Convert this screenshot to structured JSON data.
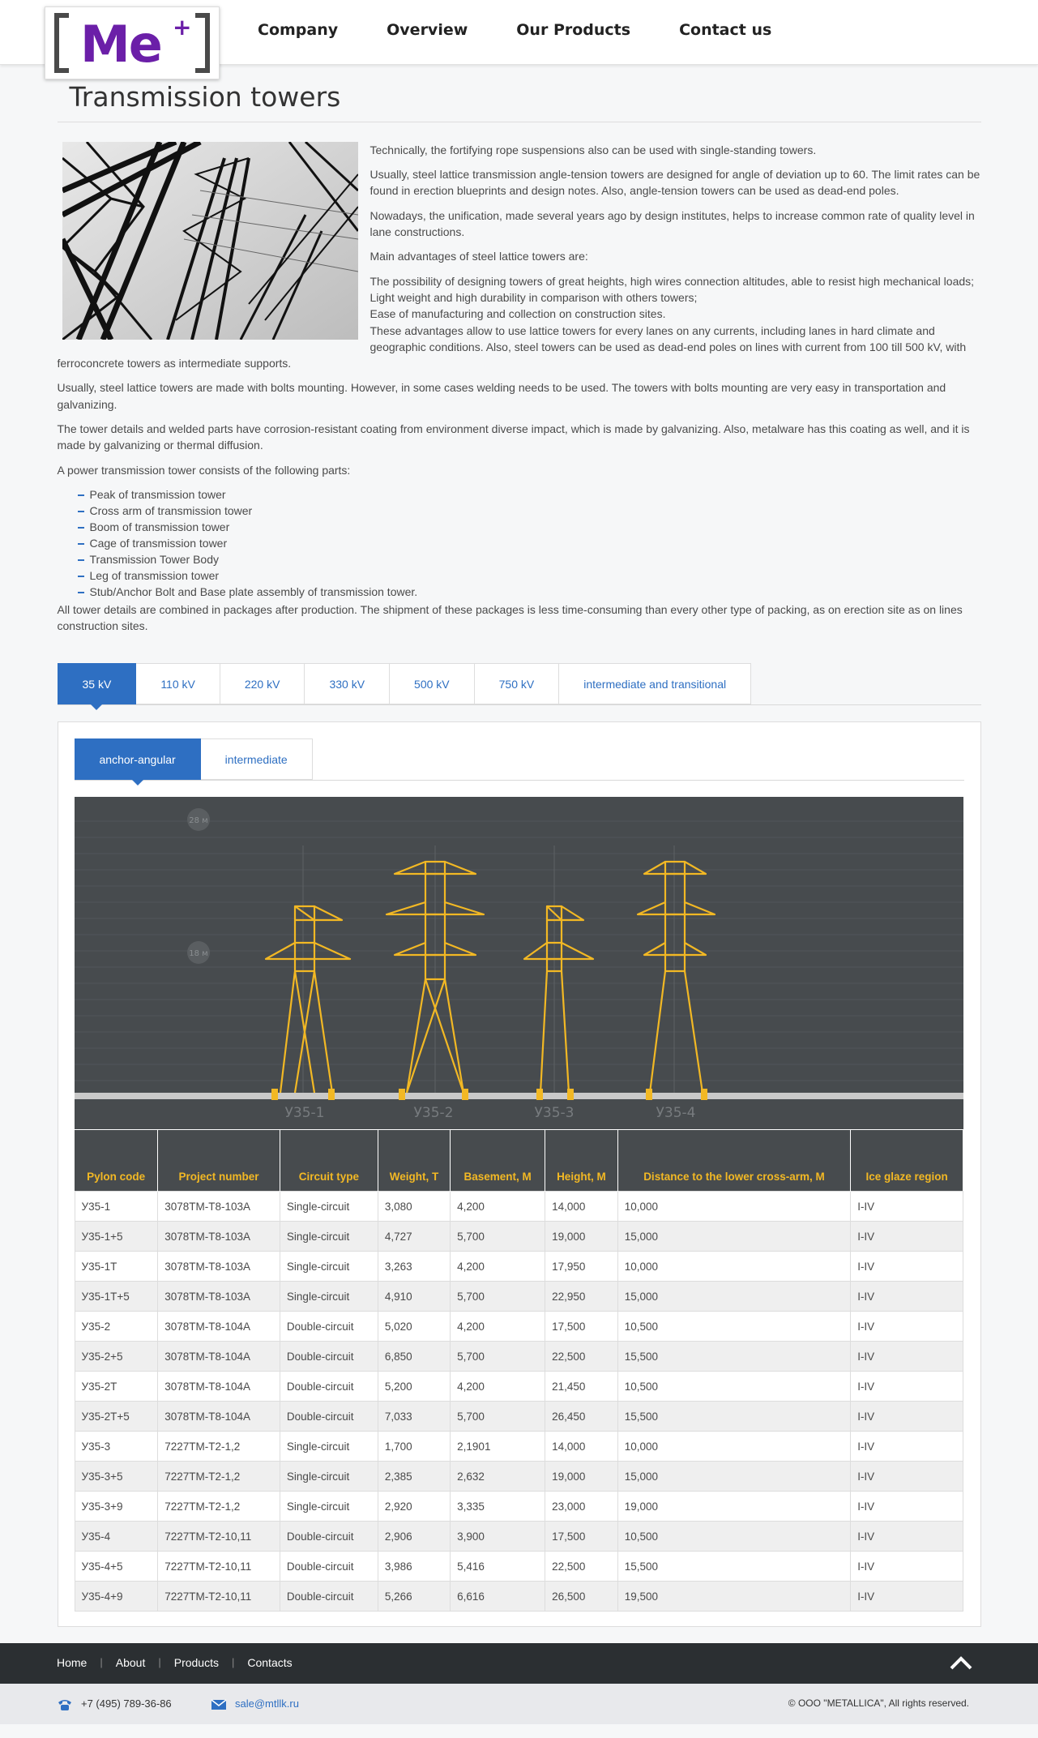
{
  "nav": {
    "logo_text": "Me",
    "logo_sup": "+",
    "items": [
      "Company",
      "Overview",
      "Our Products",
      "Contact us"
    ]
  },
  "page": {
    "title": "Transmission towers",
    "paragraphs": [
      "Technically, the fortifying rope suspensions also can be used with single-standing towers.",
      "Usually, steel lattice transmission angle-tension towers are designed for angle of deviation up to 60. The limit rates can be found in erection blueprints and design notes. Also, angle-tension towers can be used as dead-end poles.",
      "Nowadays, the unification, made several years ago by design institutes, helps to increase common rate of quality level in lane constructions.",
      "Main advantages of steel lattice towers are:"
    ],
    "advantages": [
      "The possibility of designing towers of great heights, high wires connection altitudes, able to resist high mechanical loads;",
      "Light weight and high durability in comparison with others towers;",
      "Ease of manufacturing and collection on construction sites."
    ],
    "paragraphs2": [
      "These advantages allow to use lattice towers for every lanes on any currents, including lanes in hard climate and geographic conditions. Also, steel towers can be used as dead-end poles on lines with current from 100 till 500 kV, with ferroconcrete towers as intermediate supports.",
      "Usually, steel lattice towers are made with bolts mounting. However, in some cases welding needs to be used. The towers with bolts mounting are very easy in transportation and galvanizing.",
      "The tower details and welded parts have corrosion-resistant coating from environment diverse impact, which is made by galvanizing. Also, metalware has this coating as well, and it is made by galvanizing or thermal diffusion.",
      "A power transmission tower consists of the following parts:"
    ],
    "parts": [
      "Peak of transmission tower",
      "Cross arm of transmission tower",
      "Boom of transmission tower",
      "Cage of transmission tower",
      "Transmission Tower Body",
      "Leg of transmission tower",
      "Stub/Anchor Bolt and Base plate assembly of transmission tower."
    ],
    "final": "All tower details are combined in packages after production. The shipment of these packages is less time-consuming than every other type of packing, as on erection site as on lines construction sites."
  },
  "tabs": [
    "35 kV",
    "110 kV",
    "220 kV",
    "330 kV",
    "500 kV",
    "750 kV",
    "intermediate and transitional"
  ],
  "subtabs": [
    "anchor-angular",
    "intermediate"
  ],
  "diagram": {
    "height_marks": [
      "28 м",
      "18 м"
    ],
    "tower_labels": [
      "У35-1",
      "У35-2",
      "У35-3",
      "У35-4"
    ]
  },
  "table": {
    "headers": [
      "Pylon code",
      "Project number",
      "Circuit type",
      "Weight, T",
      "Basement, M",
      "Height, M",
      "Distance to the lower cross-arm, M",
      "Ice glaze region"
    ],
    "rows": [
      [
        "У35-1",
        "3078TM-T8-103A",
        "Single-circuit",
        "3,080",
        "4,200",
        "14,000",
        "10,000",
        "I-IV"
      ],
      [
        "У35-1+5",
        "3078TM-T8-103A",
        "Single-circuit",
        "4,727",
        "5,700",
        "19,000",
        "15,000",
        "I-IV"
      ],
      [
        "У35-1T",
        "3078TM-T8-103A",
        "Single-circuit",
        "3,263",
        "4,200",
        "17,950",
        "10,000",
        "I-IV"
      ],
      [
        "У35-1T+5",
        "3078TM-T8-103A",
        "Single-circuit",
        "4,910",
        "5,700",
        "22,950",
        "15,000",
        "I-IV"
      ],
      [
        "У35-2",
        "3078TM-T8-104A",
        "Double-circuit",
        "5,020",
        "4,200",
        "17,500",
        "10,500",
        "I-IV"
      ],
      [
        "У35-2+5",
        "3078TM-T8-104A",
        "Double-circuit",
        "6,850",
        "5,700",
        "22,500",
        "15,500",
        "I-IV"
      ],
      [
        "У35-2T",
        "3078TM-T8-104A",
        "Double-circuit",
        "5,200",
        "4,200",
        "21,450",
        "10,500",
        "I-IV"
      ],
      [
        "У35-2T+5",
        "3078TM-T8-104A",
        "Double-circuit",
        "7,033",
        "5,700",
        "26,450",
        "15,500",
        "I-IV"
      ],
      [
        "У35-3",
        "7227TM-T2-1,2",
        "Single-circuit",
        "1,700",
        "2,1901",
        "14,000",
        "10,000",
        "I-IV"
      ],
      [
        "У35-3+5",
        "7227TM-T2-1,2",
        "Single-circuit",
        "2,385",
        "2,632",
        "19,000",
        "15,000",
        "I-IV"
      ],
      [
        "У35-3+9",
        "7227TM-T2-1,2",
        "Single-circuit",
        "2,920",
        "3,335",
        "23,000",
        "19,000",
        "I-IV"
      ],
      [
        "У35-4",
        "7227TM-T2-10,11",
        "Double-circuit",
        "2,906",
        "3,900",
        "17,500",
        "10,500",
        "I-IV"
      ],
      [
        "У35-4+5",
        "7227TM-T2-10,11",
        "Double-circuit",
        "3,986",
        "5,416",
        "22,500",
        "15,500",
        "I-IV"
      ],
      [
        "У35-4+9",
        "7227TM-T2-10,11",
        "Double-circuit",
        "5,266",
        "6,616",
        "26,500",
        "19,500",
        "I-IV"
      ]
    ]
  },
  "footer": {
    "links": [
      "Home",
      "About",
      "Products",
      "Contacts"
    ],
    "phone": "+7 (495) 789-36-86",
    "email": "sale@mtllk.ru",
    "copyright": "© ООО \"METALLICA\", All rights reserved."
  },
  "colors": {
    "accent": "#2e6fc2",
    "brand": "#6b1fa8",
    "diagram_bg": "#474b4e",
    "tower": "#f2b824"
  }
}
